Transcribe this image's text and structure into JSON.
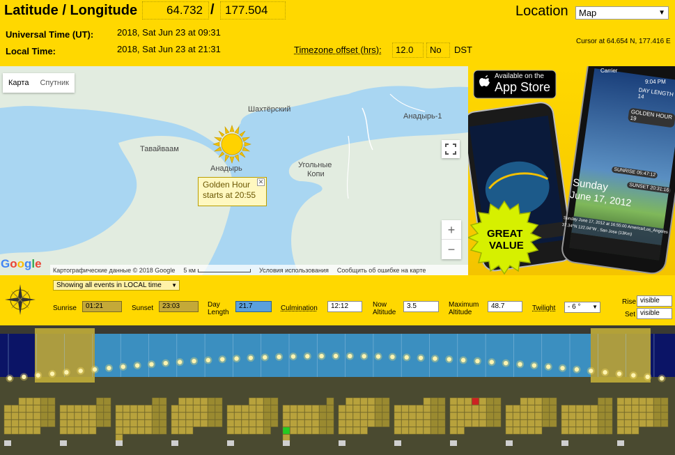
{
  "header": {
    "latlng_label": "Latitude / Longitude",
    "latitude": "64.732",
    "slash": "/",
    "longitude": "177.504",
    "ut_label": "Universal Time (UT):",
    "ut_value": "2018, Sat Jun 23 at 09:31",
    "local_label": "Local Time:",
    "local_value": "2018, Sat Jun 23 at 21:31",
    "tz_label": "Timezone offset (hrs):",
    "tz_value": "12.0",
    "dst_value": "No",
    "dst_label": "DST",
    "location_label": "Location",
    "location_select": "Map",
    "cursor_text": "Cursor at 64.654 N, 177.416 E"
  },
  "map": {
    "tabs": [
      "Карта",
      "Спутник"
    ],
    "places": {
      "shakhtersky": "Шахтёрский",
      "anadyr1": "Анадырь-1",
      "tavaivaam": "Тавайваам",
      "anadyr": "Анадырь",
      "ugolnye1": "Угольные",
      "ugolnye2": "Копи"
    },
    "popup_line1": "Golden Hour",
    "popup_line2": "starts at 20:55",
    "popup_close": "✕",
    "google": "Google",
    "footer": {
      "data": "Картографические данные © 2018 Google",
      "scale": "5 км",
      "terms": "Условия использования",
      "report": "Сообщить об ошибке на карте"
    },
    "zoom_in": "+",
    "zoom_out": "−"
  },
  "ad": {
    "available": "Available on the",
    "store": "App Store",
    "great": "GREAT",
    "value": "VALUE",
    "carrier": "Carrier",
    "time": "9:04 PM",
    "day_length": "DAY LENGTH 14",
    "golden_hour": "GOLDEN HOUR 19",
    "sunrise": "SUNRISE 05:47:12",
    "sunset": "SUNSET 20:31:16",
    "date1": "Sunday",
    "date2": "June 17, 2012",
    "foot1": "Sunday June 17, 2012 at 16:55:00 America/Los_Angeles",
    "foot2": "37.34°N 122.04°W , San Jose (13Km)"
  },
  "controls": {
    "events_select": "Showing all events in LOCAL time",
    "sunrise_label": "Sunrise",
    "sunrise_value": "01:21",
    "sunset_label": "Sunset",
    "sunset_value": "23:03",
    "daylength_label1": "Day",
    "daylength_label2": "Length",
    "daylength_value": "21.7",
    "culmination_label": "Culmination",
    "culmination_value": "12:12",
    "now_alt_label1": "Now",
    "now_alt_label2": "Altitude",
    "now_alt_value": "3.5",
    "max_alt_label1": "Maximum",
    "max_alt_label2": "Altitude",
    "max_alt_value": "48.7",
    "twilight_label": "Twilight",
    "twilight_value": "- 6 °",
    "rise_label": "Rise",
    "rise_value": "visible",
    "set_label": "Set",
    "set_value": "visible"
  },
  "colors": {
    "yellow": "#ffd800",
    "sky": "#3b8fc0",
    "night": "#0b1466",
    "golden": "#c9b43a",
    "ground": "#4a4a30"
  }
}
